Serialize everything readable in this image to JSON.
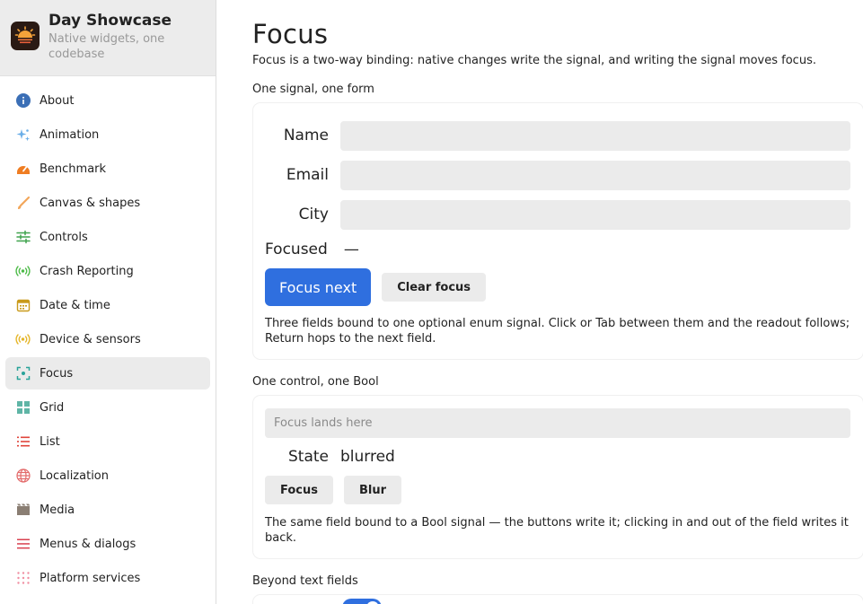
{
  "app": {
    "title": "Day Showcase",
    "subtitle": "Native widgets, one codebase"
  },
  "sidebar": {
    "items": [
      {
        "label": "About",
        "icon": "info-icon",
        "color": "#3b6fb6"
      },
      {
        "label": "Animation",
        "icon": "sparkle-icon",
        "color": "#6aaee8"
      },
      {
        "label": "Benchmark",
        "icon": "gauge-icon",
        "color": "#ef7d22"
      },
      {
        "label": "Canvas & shapes",
        "icon": "brush-icon",
        "color": "#f2a65a"
      },
      {
        "label": "Controls",
        "icon": "sliders-icon",
        "color": "#3fa34d"
      },
      {
        "label": "Crash Reporting",
        "icon": "broadcast-icon",
        "color": "#4cbb47"
      },
      {
        "label": "Date & time",
        "icon": "calendar-icon",
        "color": "#c99a1b"
      },
      {
        "label": "Device & sensors",
        "icon": "sensor-icon",
        "color": "#e5b62a"
      },
      {
        "label": "Focus",
        "icon": "focus-icon",
        "color": "#2aa39a"
      },
      {
        "label": "Grid",
        "icon": "grid-icon",
        "color": "#5fb5a6"
      },
      {
        "label": "List",
        "icon": "list-icon",
        "color": "#e0453b"
      },
      {
        "label": "Localization",
        "icon": "globe-icon",
        "color": "#e36b6b"
      },
      {
        "label": "Media",
        "icon": "film-icon",
        "color": "#8a7e73"
      },
      {
        "label": "Menus & dialogs",
        "icon": "menu-icon",
        "color": "#d9414f"
      },
      {
        "label": "Platform services",
        "icon": "dots-grid-icon",
        "color": "#f08fa2"
      }
    ],
    "active_index": 8
  },
  "main": {
    "title": "Focus",
    "description": "Focus is a two-way binding: native changes write the signal, and writing the signal moves focus.",
    "section1": {
      "label": "One signal, one form",
      "fields": [
        {
          "label": "Name",
          "value": ""
        },
        {
          "label": "Email",
          "value": ""
        },
        {
          "label": "City",
          "value": ""
        }
      ],
      "readout_label": "Focused",
      "readout_value": "—",
      "focus_next_label": "Focus next",
      "clear_focus_label": "Clear focus",
      "help": "Three fields bound to one optional enum signal. Click or Tab between them and the readout follows; Return hops to the next field."
    },
    "section2": {
      "label": "One control, one Bool",
      "placeholder": "Focus lands here",
      "state_label": "State",
      "state_value": "blurred",
      "focus_label": "Focus",
      "blur_label": "Blur",
      "help": "The same field bound to a Bool signal — the buttons write it; clicking in and out of the field writes it back."
    },
    "section3": {
      "label": "Beyond text fields",
      "toggle_on": true
    }
  },
  "colors": {
    "accent": "#2f6fdf",
    "active_nav": "#ebebeb",
    "input_bg": "#ebebeb"
  }
}
